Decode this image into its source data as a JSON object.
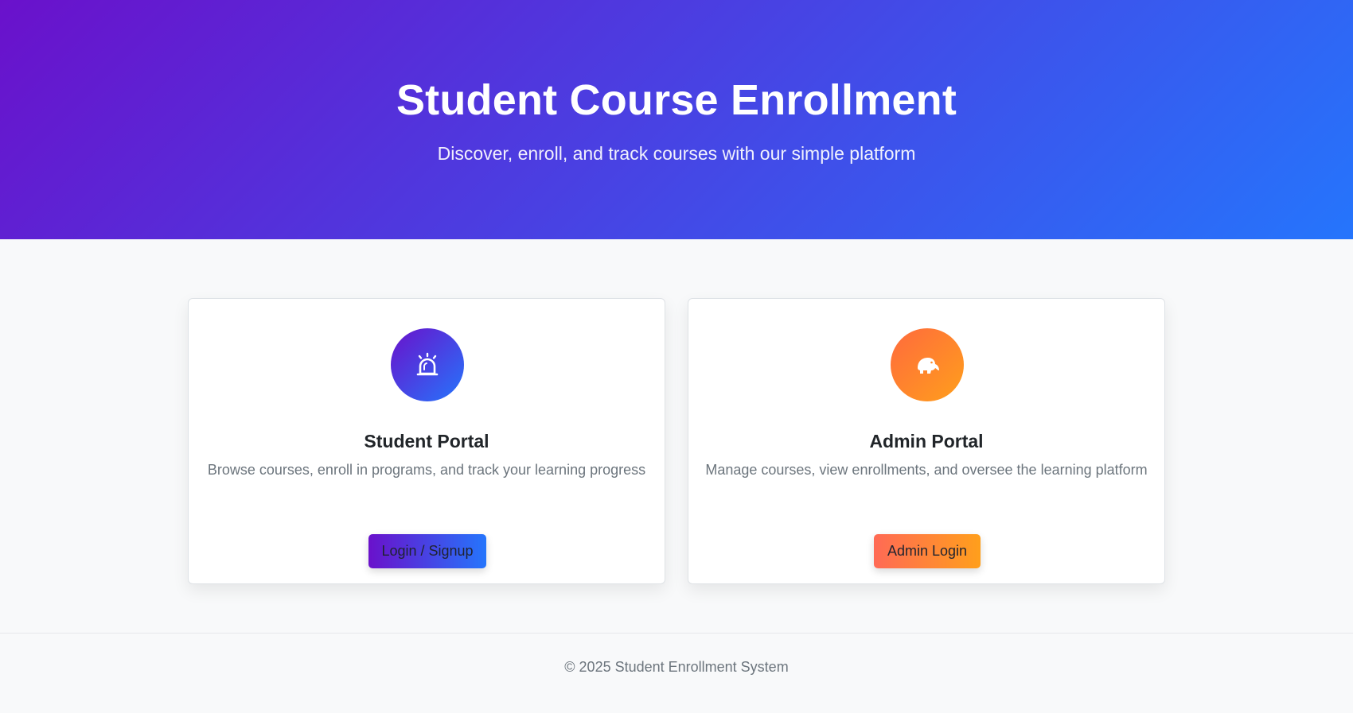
{
  "hero": {
    "title": "Student Course Enrollment",
    "subtitle": "Discover, enroll, and track courses with our simple platform"
  },
  "cards": {
    "student": {
      "icon": "alarm-bell-icon",
      "title": "Student Portal",
      "description": "Browse courses, enroll in programs, and track your learning progress",
      "button_label": "Login / Signup"
    },
    "admin": {
      "icon": "elephant-icon",
      "title": "Admin Portal",
      "description": "Manage courses, view enrollments, and oversee the learning platform",
      "button_label": "Admin Login"
    }
  },
  "footer": {
    "text": "© 2025 Student Enrollment System"
  },
  "colors": {
    "hero_gradient_start": "#6a11cb",
    "hero_gradient_end": "#2575fc",
    "admin_gradient_start": "#ff6a3d",
    "admin_gradient_end": "#ff9f1c",
    "page_background": "#f8f9fa"
  }
}
